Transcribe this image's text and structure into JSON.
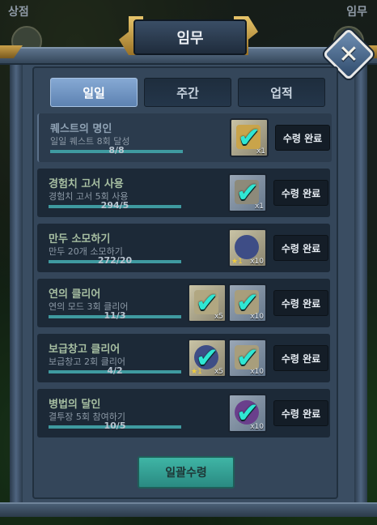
{
  "background": {
    "left_label": "상점",
    "right_label": "임무"
  },
  "window": {
    "title": "임무",
    "close_icon": "close-x-icon"
  },
  "tabs": [
    {
      "label": "일일",
      "active": true
    },
    {
      "label": "주간",
      "active": false
    },
    {
      "label": "업적",
      "active": false
    }
  ],
  "quests": [
    {
      "title": "퀘스트의 명인",
      "description": "일일 퀘스트 8회 달성",
      "progress_text": "8/8",
      "progress": 1.0,
      "rewards": [
        {
          "icon": "key-icon",
          "qty": "x1",
          "style": "gold"
        }
      ],
      "button": "수령 완료"
    },
    {
      "title": "경험치 고서 사용",
      "description": "경험치 고서 5회 사용",
      "progress_text": "294/5",
      "progress": 1.0,
      "rewards": [
        {
          "icon": "book-icon",
          "qty": "x1",
          "style": "silver"
        }
      ],
      "button": "수령 완료"
    },
    {
      "title": "만두 소모하기",
      "description": "만두 20개 소모하기",
      "progress_text": "272/20",
      "progress": 1.0,
      "rewards": [
        {
          "icon": "gem-icon",
          "qty": "x10",
          "star": "1",
          "style": "gold"
        }
      ],
      "button": "수령 완료"
    },
    {
      "title": "연의 클리어",
      "description": "연의 모드 3회 클리어",
      "progress_text": "11/3",
      "progress": 1.0,
      "rewards": [
        {
          "icon": "book-icon",
          "qty": "x5",
          "style": "gold"
        },
        {
          "icon": "key-icon",
          "qty": "x10",
          "style": "silver"
        }
      ],
      "button": "수령 완료"
    },
    {
      "title": "보급창고 클리어",
      "description": "보급창고 2회 클리어",
      "progress_text": "4/2",
      "progress": 1.0,
      "rewards": [
        {
          "icon": "gem-icon",
          "qty": "x5",
          "star": "1",
          "style": "gold"
        },
        {
          "icon": "key-icon",
          "qty": "x10",
          "style": "silver"
        }
      ],
      "button": "수령 완료"
    },
    {
      "title": "병법의 달인",
      "description": "결투장 5회 참여하기",
      "progress_text": "10/5",
      "progress": 1.0,
      "rewards": [
        {
          "icon": "orb-icon",
          "qty": "x10",
          "style": "silver"
        }
      ],
      "button": "수령 완료"
    }
  ],
  "claim_all_button": "일괄수령",
  "colors": {
    "accent_teal": "#3fb5a5",
    "check_cyan": "#2fe6d3",
    "tab_active": "#6d91bf",
    "gold_trim": "#c9a04a"
  }
}
